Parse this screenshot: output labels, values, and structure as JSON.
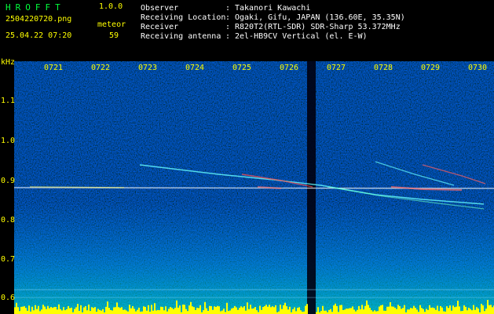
{
  "header": {
    "title": "HROFFT",
    "version": "1.0.0",
    "filename": "2504220720.png",
    "datetime": "25.04.22 07:20",
    "meteor_label": "meteor",
    "meteor_count": "59"
  },
  "metadata": [
    {
      "label": "Observer",
      "sep": ":",
      "value": "Takanori Kawachi"
    },
    {
      "label": "Receiving Location",
      "sep": ":",
      "value": "Ogaki, Gifu, JAPAN (136.60E, 35.35N)"
    },
    {
      "label": "Receiver",
      "sep": ":",
      "value": "R820T2(RTL-SDR) SDR-Sharp 53.372MHz"
    },
    {
      "label": "Receiving antenna",
      "sep": ":",
      "value": "2el-HB9CV Vertical (el. E-W)"
    }
  ],
  "axis": {
    "y_unit": "kHz",
    "y_ticks": [
      "1.1",
      "1.0",
      "0.9",
      "0.8",
      "0.7",
      "0.6"
    ],
    "x_ticks": [
      "0721",
      "0722",
      "0723",
      "0724",
      "0725",
      "0726",
      "0727",
      "0728",
      "0729",
      "0730"
    ]
  },
  "colors": {
    "header_yellow": "#ffff00",
    "header_green": "#00ff3c",
    "background": "#000000",
    "spectrogram_bg": "#00002a"
  }
}
